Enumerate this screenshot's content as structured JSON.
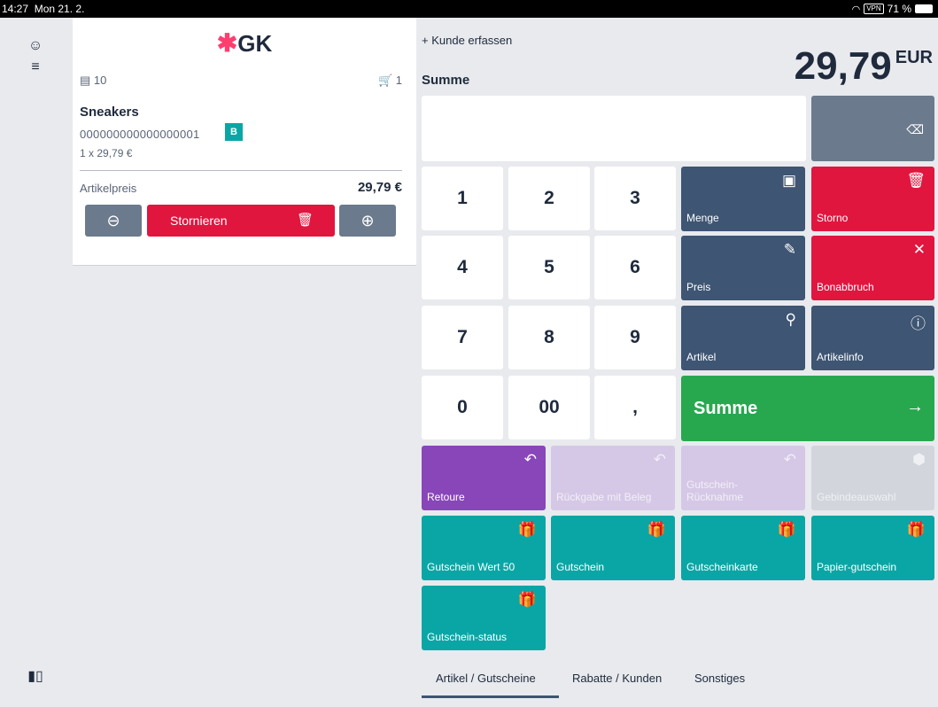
{
  "status_bar": {
    "time": "14:27",
    "date": "Mon 21. 2.",
    "vpn": "VPN",
    "battery": "71 %"
  },
  "rail": {
    "customer_list_icon": "customer-list-icon",
    "barcode_icon": "barcode-icon"
  },
  "receipt": {
    "logo_text": "GK",
    "receipt_count": "10",
    "cart_count": "1",
    "item": {
      "name": "Sneakers",
      "ean": "000000000000000001",
      "badge": "B",
      "qty_price": "1 x 29,79 €"
    },
    "price_label": "Artikelpreis",
    "price_value": "29,79 €",
    "storno_label": "Stornieren"
  },
  "header": {
    "customer_link": "+ Kunde erfassen",
    "sum_label": "Summe",
    "total": "29,79",
    "currency": "EUR"
  },
  "keypad": {
    "keys": [
      "1",
      "2",
      "3",
      "4",
      "5",
      "6",
      "7",
      "8",
      "9",
      "0",
      "00",
      ","
    ]
  },
  "functions": {
    "menge": "Menge",
    "storno": "Storno",
    "preis": "Preis",
    "bonabbruch": "Bonabbruch",
    "artikel": "Artikel",
    "artikelinfo": "Artikelinfo",
    "summe": "Summe"
  },
  "actions": {
    "retoure": "Retoure",
    "rueckgabe": "Rückgabe mit Beleg",
    "gutschein_ruecknahme": "Gutschein-Rücknahme",
    "gebindeauswahl": "Gebindeauswahl",
    "gutschein_wert": "Gutschein Wert 50",
    "gutschein": "Gutschein",
    "gutscheinkarte": "Gutscheinkarte",
    "papier_gutschein": "Papier-gutschein",
    "gutschein_status": "Gutschein-status"
  },
  "tabs": {
    "items": [
      "Artikel / Gutscheine",
      "Rabatte / Kunden",
      "Sonstiges"
    ],
    "active_index": 0
  },
  "colors": {
    "slate": "#3e5573",
    "red": "#e0163f",
    "green": "#27a84f",
    "purple": "#8846b9",
    "teal": "#0aa6a6"
  }
}
